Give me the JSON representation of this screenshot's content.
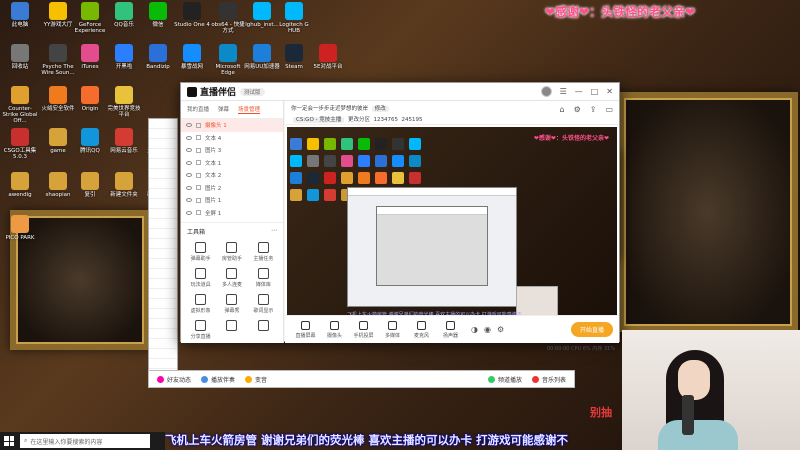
{
  "banner": "❤感谢❤：头铁怪的老父亲❤",
  "desktop_icons": [
    {
      "label": "此电脑",
      "color": "#3a7bd5"
    },
    {
      "label": "YY游戏大厅",
      "color": "#f6c000"
    },
    {
      "label": "GeForce Experience",
      "color": "#76b900"
    },
    {
      "label": "QQ音乐",
      "color": "#31c27c"
    },
    {
      "label": "微信",
      "color": "#09bb07"
    },
    {
      "label": "Studio One 4",
      "color": "#222"
    },
    {
      "label": "obs64 - 快捷方式",
      "color": "#333"
    },
    {
      "label": "lghub_inst...",
      "color": "#00b8fc"
    },
    {
      "label": "Logitech G HUB",
      "color": "#00b8fc"
    },
    {
      "label": "回收站",
      "color": "#777"
    },
    {
      "label": "Psycho The Wire Soun...",
      "color": "#444"
    },
    {
      "label": "iTunes",
      "color": "#e24d8e"
    },
    {
      "label": "开黑啦",
      "color": "#2b7fff"
    },
    {
      "label": "Bandizip",
      "color": "#2b6fd8"
    },
    {
      "label": "暴雪战网",
      "color": "#148eff"
    },
    {
      "label": "Microsoft Edge",
      "color": "#0c8ac7"
    },
    {
      "label": "网易UU加速器",
      "color": "#1e7fdb"
    },
    {
      "label": "Steam",
      "color": "#1b2838"
    },
    {
      "label": "5E对战平台",
      "color": "#c22"
    },
    {
      "label": "Counter-Strike Global Off...",
      "color": "#e0a030"
    },
    {
      "label": "火绒安全软件",
      "color": "#f07a1e"
    },
    {
      "label": "Origin",
      "color": "#f56c2d"
    },
    {
      "label": "完美世界竞技平台",
      "color": "#e8c23a"
    },
    {
      "label": "CSGO工具集 5.0.3",
      "color": "#c83030"
    },
    {
      "label": "game",
      "color": "#d6a33a"
    },
    {
      "label": "腾讯QQ",
      "color": "#1296db"
    },
    {
      "label": "网易云音乐",
      "color": "#d43c33"
    },
    {
      "label": "元气骑士",
      "color": "#c93"
    },
    {
      "label": "awendig",
      "color": "#d6a33a"
    },
    {
      "label": "shaopian",
      "color": "#d6a33a"
    },
    {
      "label": "复引",
      "color": "#d6a33a"
    },
    {
      "label": "新建文件夹",
      "color": "#d6a33a"
    },
    {
      "label": "新建文本",
      "color": "#d6a33a"
    },
    {
      "label": "PICO PARK",
      "color": "#e94"
    }
  ],
  "app": {
    "name": "直播伴侣",
    "version_pill": "测试版",
    "left_tabs": [
      "我的直播",
      "弹幕",
      "场景管理"
    ],
    "scenes": [
      "摄像头 1",
      "文本 4",
      "图片 3",
      "文本 1",
      "文本 2",
      "图片 2",
      "图片 1",
      "全屏 1"
    ],
    "tools_title": "工具箱",
    "tools": [
      "弹幕助手",
      "房管助手",
      "主播任务",
      "玩法道具",
      "多人连麦",
      "媒体库",
      "虚拟形象",
      "弹幕秀",
      "歌词显示",
      "分享直播",
      "",
      ""
    ],
    "info_title": "你一定会一步步走近梦想的彼岸",
    "info_badge": "修改",
    "category": "CS:GO - 竞技主播",
    "change": "更改分区",
    "stats": [
      "1234765",
      "245195"
    ],
    "preview_banner": "❤感谢❤：头铁怪的老父亲❤",
    "preview_ticker": "飞机上车火箭房管 谢谢兄弟们的荧光棒 喜欢主播的可以办卡 打游戏可能感谢不",
    "bottom_actions": [
      "直播屏幕",
      "摄像头",
      "手机投屏",
      "多媒体",
      "麦克风",
      "扬声器"
    ],
    "start_button": "开始直播",
    "status": "00:00:00  CPU 6%  内存 31%",
    "app_bar_items": [
      "好友动态",
      "播放伴奏",
      "变音",
      "频道播放",
      "音乐列表"
    ]
  },
  "taskbar": {
    "search_placeholder": "在这里输入你要搜索的内容"
  },
  "ticker": "飞机上车火箭房管 谢谢兄弟们的荧光棒 喜欢主播的可以办卡 打游戏可能感谢不",
  "cam_caption": "别抽"
}
